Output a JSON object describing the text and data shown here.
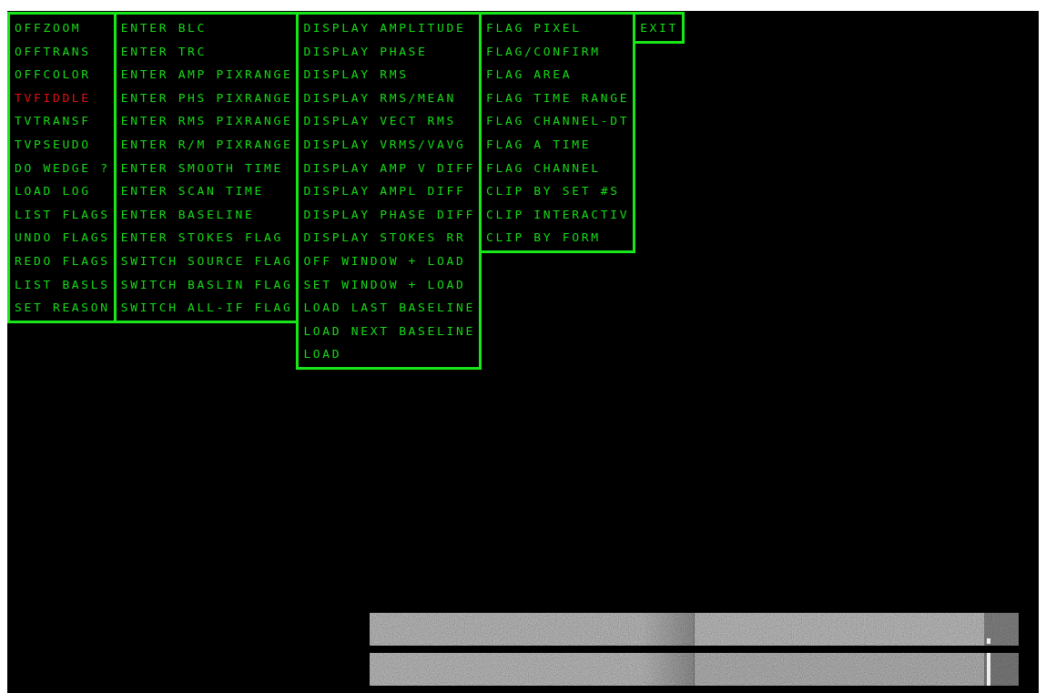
{
  "menus": [
    {
      "items": [
        {
          "label": "OFFZOOM",
          "selected": false
        },
        {
          "label": "OFFTRANS",
          "selected": false
        },
        {
          "label": "OFFCOLOR",
          "selected": false
        },
        {
          "label": "TVFIDDLE",
          "selected": true
        },
        {
          "label": "TVTRANSF",
          "selected": false
        },
        {
          "label": "TVPSEUDO",
          "selected": false
        },
        {
          "label": "DO WEDGE ?",
          "selected": false
        },
        {
          "label": "LOAD LOG",
          "selected": false
        },
        {
          "label": "LIST FLAGS",
          "selected": false
        },
        {
          "label": "UNDO FLAGS",
          "selected": false
        },
        {
          "label": "REDO FLAGS",
          "selected": false
        },
        {
          "label": "LIST BASLS",
          "selected": false
        },
        {
          "label": "SET REASON",
          "selected": false
        }
      ]
    },
    {
      "items": [
        {
          "label": "ENTER BLC",
          "selected": false
        },
        {
          "label": "ENTER TRC",
          "selected": false
        },
        {
          "label": "ENTER AMP PIXRANGE",
          "selected": false
        },
        {
          "label": "ENTER PHS PIXRANGE",
          "selected": false
        },
        {
          "label": "ENTER RMS PIXRANGE",
          "selected": false
        },
        {
          "label": "ENTER R/M PIXRANGE",
          "selected": false
        },
        {
          "label": "ENTER SMOOTH TIME",
          "selected": false
        },
        {
          "label": "ENTER SCAN TIME",
          "selected": false
        },
        {
          "label": "ENTER BASELINE",
          "selected": false
        },
        {
          "label": "ENTER STOKES FLAG",
          "selected": false
        },
        {
          "label": "SWITCH SOURCE FLAG",
          "selected": false
        },
        {
          "label": "SWITCH BASLIN FLAG",
          "selected": false
        },
        {
          "label": "SWITCH ALL-IF FLAG",
          "selected": false
        }
      ]
    },
    {
      "items": [
        {
          "label": "DISPLAY AMPLITUDE",
          "selected": false
        },
        {
          "label": "DISPLAY PHASE",
          "selected": false
        },
        {
          "label": "DISPLAY RMS",
          "selected": false
        },
        {
          "label": "DISPLAY RMS/MEAN",
          "selected": false
        },
        {
          "label": "DISPLAY VECT RMS",
          "selected": false
        },
        {
          "label": "DISPLAY VRMS/VAVG",
          "selected": false
        },
        {
          "label": "DISPLAY AMP V DIFF",
          "selected": false
        },
        {
          "label": "DISPLAY AMPL DIFF",
          "selected": false
        },
        {
          "label": "DISPLAY PHASE DIFF",
          "selected": false
        },
        {
          "label": "DISPLAY STOKES RR",
          "selected": false
        },
        {
          "label": "OFF WINDOW + LOAD",
          "selected": false
        },
        {
          "label": "SET WINDOW + LOAD",
          "selected": false
        },
        {
          "label": "LOAD LAST BASELINE",
          "selected": false
        },
        {
          "label": "LOAD NEXT BASELINE",
          "selected": false
        },
        {
          "label": "LOAD",
          "selected": false
        }
      ]
    },
    {
      "items": [
        {
          "label": "FLAG PIXEL",
          "selected": false
        },
        {
          "label": "FLAG/CONFIRM",
          "selected": false
        },
        {
          "label": "FLAG AREA",
          "selected": false
        },
        {
          "label": "FLAG TIME RANGE",
          "selected": false
        },
        {
          "label": "FLAG CHANNEL-DT",
          "selected": false
        },
        {
          "label": "FLAG A TIME",
          "selected": false
        },
        {
          "label": "FLAG CHANNEL",
          "selected": false
        },
        {
          "label": "CLIP BY SET #S",
          "selected": false
        },
        {
          "label": "CLIP INTERACTIV",
          "selected": false
        },
        {
          "label": "CLIP BY FORM",
          "selected": false
        }
      ]
    },
    {
      "items": [
        {
          "label": "EXIT",
          "selected": false
        }
      ]
    }
  ]
}
